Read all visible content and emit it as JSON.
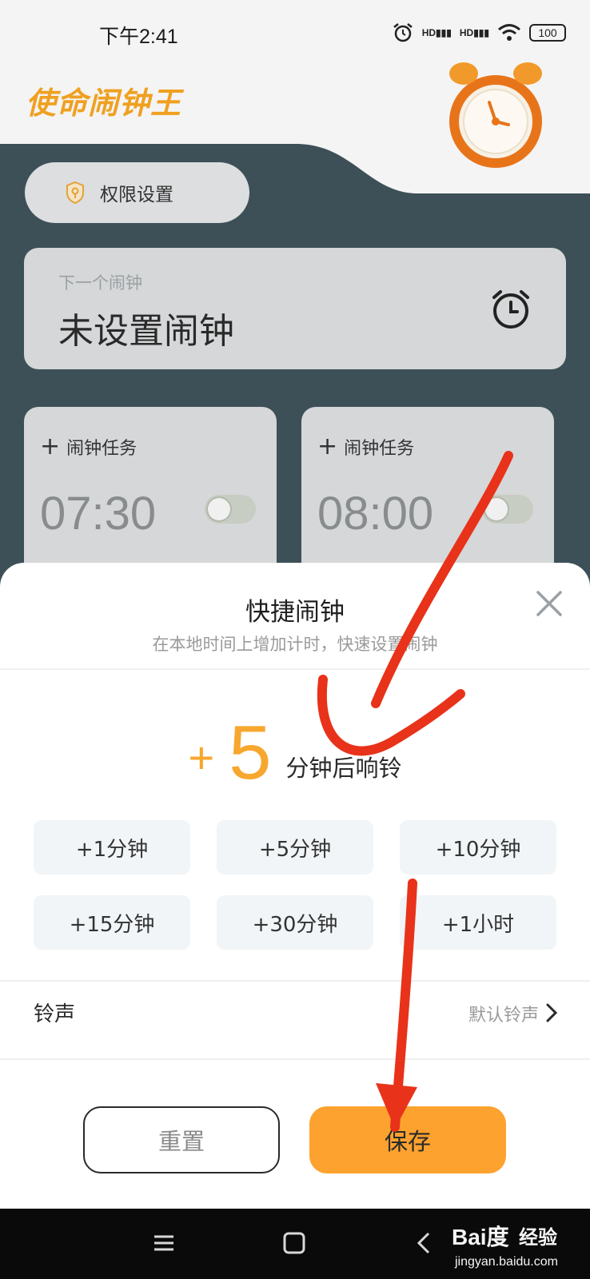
{
  "status_bar": {
    "time": "下午2:41",
    "battery": "100",
    "signal_labels": [
      "HD",
      "HD"
    ]
  },
  "app": {
    "title": "使命闹钟王"
  },
  "permission_button": {
    "label": "权限设置"
  },
  "next_alarm": {
    "label": "下一个闹钟",
    "value": "未设置闹钟"
  },
  "tasks": [
    {
      "header": "闹钟任务",
      "time": "07:30",
      "enabled": false
    },
    {
      "header": "闹钟任务",
      "time": "08:00",
      "enabled": false
    }
  ],
  "sheet": {
    "title": "快捷闹钟",
    "subtitle": "在本地时间上增加计时，快速设置闹钟",
    "offset_plus": "+",
    "offset_value": "5",
    "offset_unit": "分钟后响铃",
    "options": [
      "+1分钟",
      "+5分钟",
      "+10分钟",
      "+15分钟",
      "+30分钟",
      "+1小时"
    ],
    "ringtone_label": "铃声",
    "ringtone_value": "默认铃声",
    "reset_label": "重置",
    "save_label": "保存"
  },
  "watermark": {
    "logo": "Bai度",
    "brand": "经验",
    "url": "jingyan.baidu.com"
  },
  "colors": {
    "accent": "#fda22e",
    "accent_text": "#f7a72e",
    "annotation": "#e8321a",
    "dark_bg": "#3d5058"
  }
}
